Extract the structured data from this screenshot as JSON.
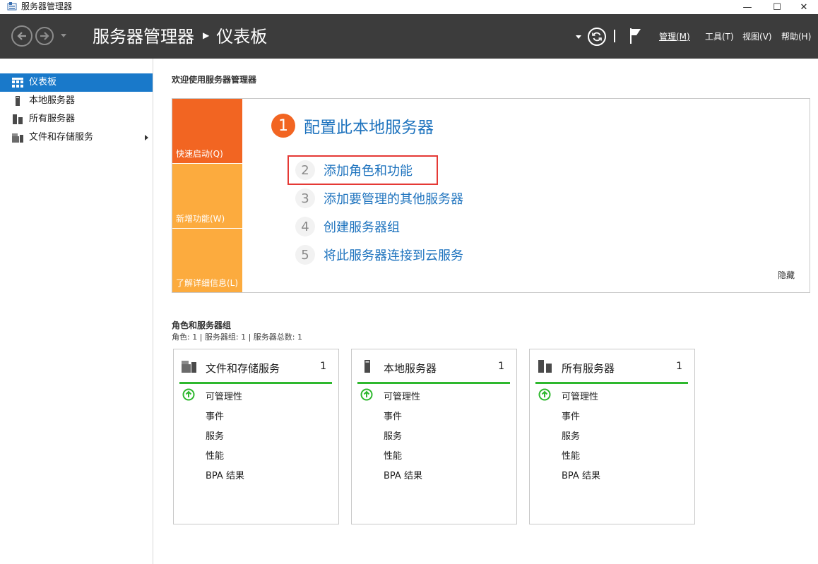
{
  "window": {
    "title": "服务器管理器",
    "minimize": "—",
    "maximize": "☐",
    "close": "✕"
  },
  "header": {
    "breadcrumb_root": "服务器管理器",
    "breadcrumb_sep": "▶",
    "breadcrumb_current": "仪表板",
    "menus": [
      "管理(M)",
      "工具(T)",
      "视图(V)",
      "帮助(H)"
    ]
  },
  "sidebar": {
    "items": [
      {
        "label": "仪表板",
        "icon": "dashboard-icon",
        "selected": true
      },
      {
        "label": "本地服务器",
        "icon": "server-icon"
      },
      {
        "label": "所有服务器",
        "icon": "servers-icon"
      },
      {
        "label": "文件和存储服务",
        "icon": "file-storage-icon",
        "has_arrow": true
      }
    ]
  },
  "welcome": {
    "title": "欢迎使用服务器管理器",
    "tiles": [
      "快速启动(Q)",
      "新增功能(W)",
      "了解详细信息(L)"
    ],
    "tile_colors": [
      "#f26522",
      "#fcab3e",
      "#fcab3e"
    ],
    "steps": [
      {
        "num": "1",
        "text": "配置此本地服务器"
      },
      {
        "num": "2",
        "text": "添加角色和功能"
      },
      {
        "num": "3",
        "text": "添加要管理的其他服务器"
      },
      {
        "num": "4",
        "text": "创建服务器组"
      },
      {
        "num": "5",
        "text": "将此服务器连接到云服务"
      }
    ],
    "hide": "隐藏"
  },
  "roles": {
    "title": "角色和服务器组",
    "subtitle": "角色: 1 | 服务器组: 1 | 服务器总数: 1",
    "cards": [
      {
        "title": "文件和存储服务",
        "count": "1",
        "icon": "file-storage-icon",
        "rows": [
          "可管理性",
          "事件",
          "服务",
          "性能",
          "BPA 结果"
        ]
      },
      {
        "title": "本地服务器",
        "count": "1",
        "icon": "server-icon",
        "rows": [
          "可管理性",
          "事件",
          "服务",
          "性能",
          "BPA 结果"
        ]
      },
      {
        "title": "所有服务器",
        "count": "1",
        "icon": "servers-icon",
        "rows": [
          "可管理性",
          "事件",
          "服务",
          "性能",
          "BPA 结果"
        ]
      }
    ]
  },
  "colors": {
    "header_bg": "#3c3c3c",
    "selected": "#1979ca",
    "link": "#1e73be",
    "status_ok": "#2eb82e",
    "accent_orange": "#f26522"
  }
}
